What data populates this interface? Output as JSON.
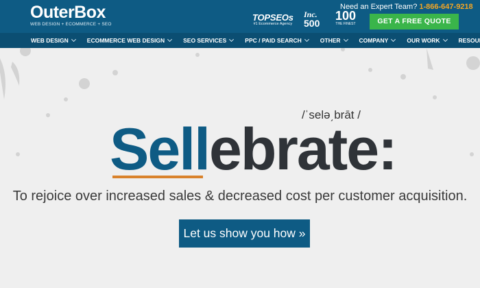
{
  "header": {
    "logo_name": "OuterBox",
    "logo_tagline": "WEB DESIGN + ECOMMERCE + SEO",
    "badges": {
      "topseos": "TOPSEOs",
      "topseos_sub": "#1 Ecommerce Agency",
      "inc": "Inc.",
      "inc_500": "500",
      "hundred": "100",
      "hundred_sub": "THE FINEST"
    },
    "expert_text": "Need an Expert Team?",
    "phone": "1-866-647-9218",
    "quote_button": "GET A FREE QUOTE"
  },
  "nav": {
    "items": [
      {
        "label": "WEB DESIGN",
        "dropdown": true
      },
      {
        "label": "ECOMMERCE WEB DESIGN",
        "dropdown": true
      },
      {
        "label": "SEO SERVICES",
        "dropdown": true
      },
      {
        "label": "PPC / PAID SEARCH",
        "dropdown": true
      },
      {
        "label": "OTHER",
        "dropdown": true
      },
      {
        "label": "COMPANY",
        "dropdown": true
      },
      {
        "label": "OUR WORK",
        "dropdown": true
      },
      {
        "label": "RESOURCES",
        "dropdown": false
      }
    ]
  },
  "hero": {
    "pronunciation": "/ˈselə͵brāt /",
    "word_highlight": "Sell",
    "word_rest": "ebrate:",
    "tagline": "To rejoice over increased sales & decreased cost per customer acquisition.",
    "cta": "Let us show you how »"
  },
  "colors": {
    "brand_blue": "#0e5b84",
    "nav_blue": "#0b4e72",
    "accent_orange": "#f5a623",
    "underline_orange": "#d9822b",
    "quote_green": "#3ab54a",
    "background": "#efefef"
  }
}
